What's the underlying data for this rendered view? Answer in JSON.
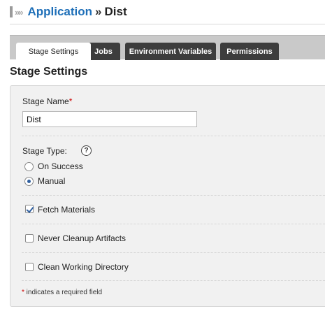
{
  "breadcrumb": {
    "arrows": "»»",
    "parent": "Application",
    "separator": "»",
    "current": "Dist"
  },
  "tabs": [
    {
      "label": "Stage Settings",
      "active": true
    },
    {
      "label": "Jobs",
      "active": false
    },
    {
      "label": "Environment Variables",
      "active": false
    },
    {
      "label": "Permissions",
      "active": false
    }
  ],
  "section_title": "Stage Settings",
  "form": {
    "stage_name": {
      "label": "Stage Name",
      "required_mark": "*",
      "value": "Dist"
    },
    "stage_type": {
      "label": "Stage Type:",
      "help": "?",
      "options": [
        {
          "label": "On Success",
          "selected": false
        },
        {
          "label": "Manual",
          "selected": true
        }
      ]
    },
    "fetch_materials": {
      "label": "Fetch Materials",
      "checked": true
    },
    "never_cleanup": {
      "label": "Never Cleanup Artifacts",
      "checked": false
    },
    "clean_working_dir": {
      "label": "Clean Working Directory",
      "checked": false
    },
    "footnote": {
      "mark": "*",
      "text": " indicates a required field"
    }
  },
  "colors": {
    "link": "#1e6fb8",
    "tab_dark": "#3d3d3d",
    "required": "#cc0000",
    "panel_bg": "#f1f1f1"
  }
}
